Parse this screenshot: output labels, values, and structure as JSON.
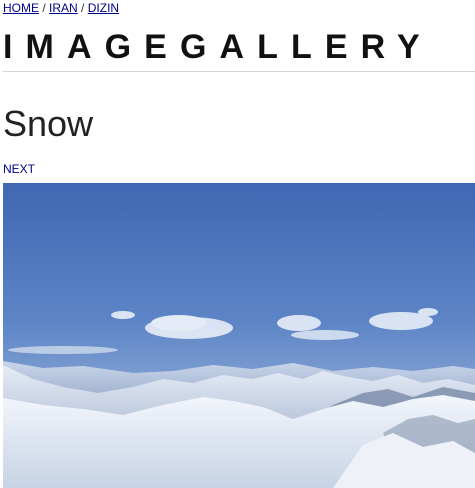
{
  "breadcrumb": {
    "items": [
      {
        "label": "HOME"
      },
      {
        "label": "IRAN"
      },
      {
        "label": "DIZIN"
      }
    ],
    "separator": "/"
  },
  "site_title": "IMAGEGALLERY",
  "page_title": "Snow",
  "nav": {
    "next_label": "NEXT"
  },
  "photo": {
    "alt": "Snow-covered mountain range under a blue sky with lenticular clouds"
  },
  "colors": {
    "link": "#00008b",
    "sky_top": "#3f6ab6",
    "sky_bottom": "#9fb8d8",
    "snow": "#eef2f8"
  }
}
